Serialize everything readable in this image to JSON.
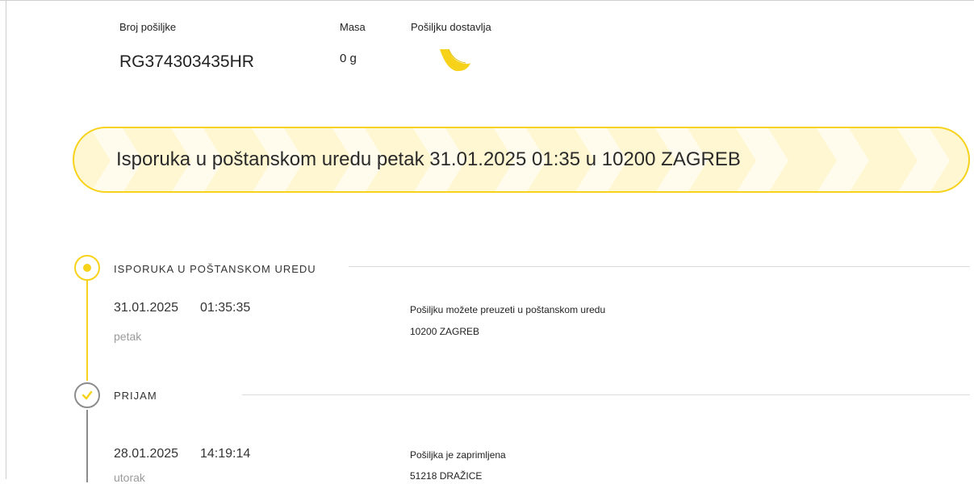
{
  "shipment": {
    "number_label": "Broj pošiljke",
    "number": "RG374303435HR",
    "weight_label": "Masa",
    "weight": "0 g",
    "carrier_label": "Pošiljku dostavlja"
  },
  "status_banner": {
    "text": "Isporuka u poštanskom uredu petak 31.01.2025 01:35 u 10200 ZAGREB"
  },
  "timeline": {
    "steps": [
      {
        "title": "ISPORUKA U POŠTANSKOM UREDU",
        "date": "31.01.2025",
        "time": "01:35:35",
        "day": "petak",
        "description": "Pošiljku možete preuzeti u poštanskom uredu",
        "location": "10200 ZAGREB"
      },
      {
        "title": "PRIJAM",
        "date": "28.01.2025",
        "time": "14:19:14",
        "day": "utorak",
        "description": "Pošiljka je zaprimljena",
        "location": "51218 DRAŽICE"
      }
    ]
  },
  "colors": {
    "accent_yellow": "#f7d21b",
    "banner_fill": "#fff7d2",
    "muted_gray": "#8c8c8c"
  },
  "icons": {
    "carrier_logo": "posthorn-logo",
    "current_step": "dot-icon",
    "completed_step": "check-icon"
  }
}
